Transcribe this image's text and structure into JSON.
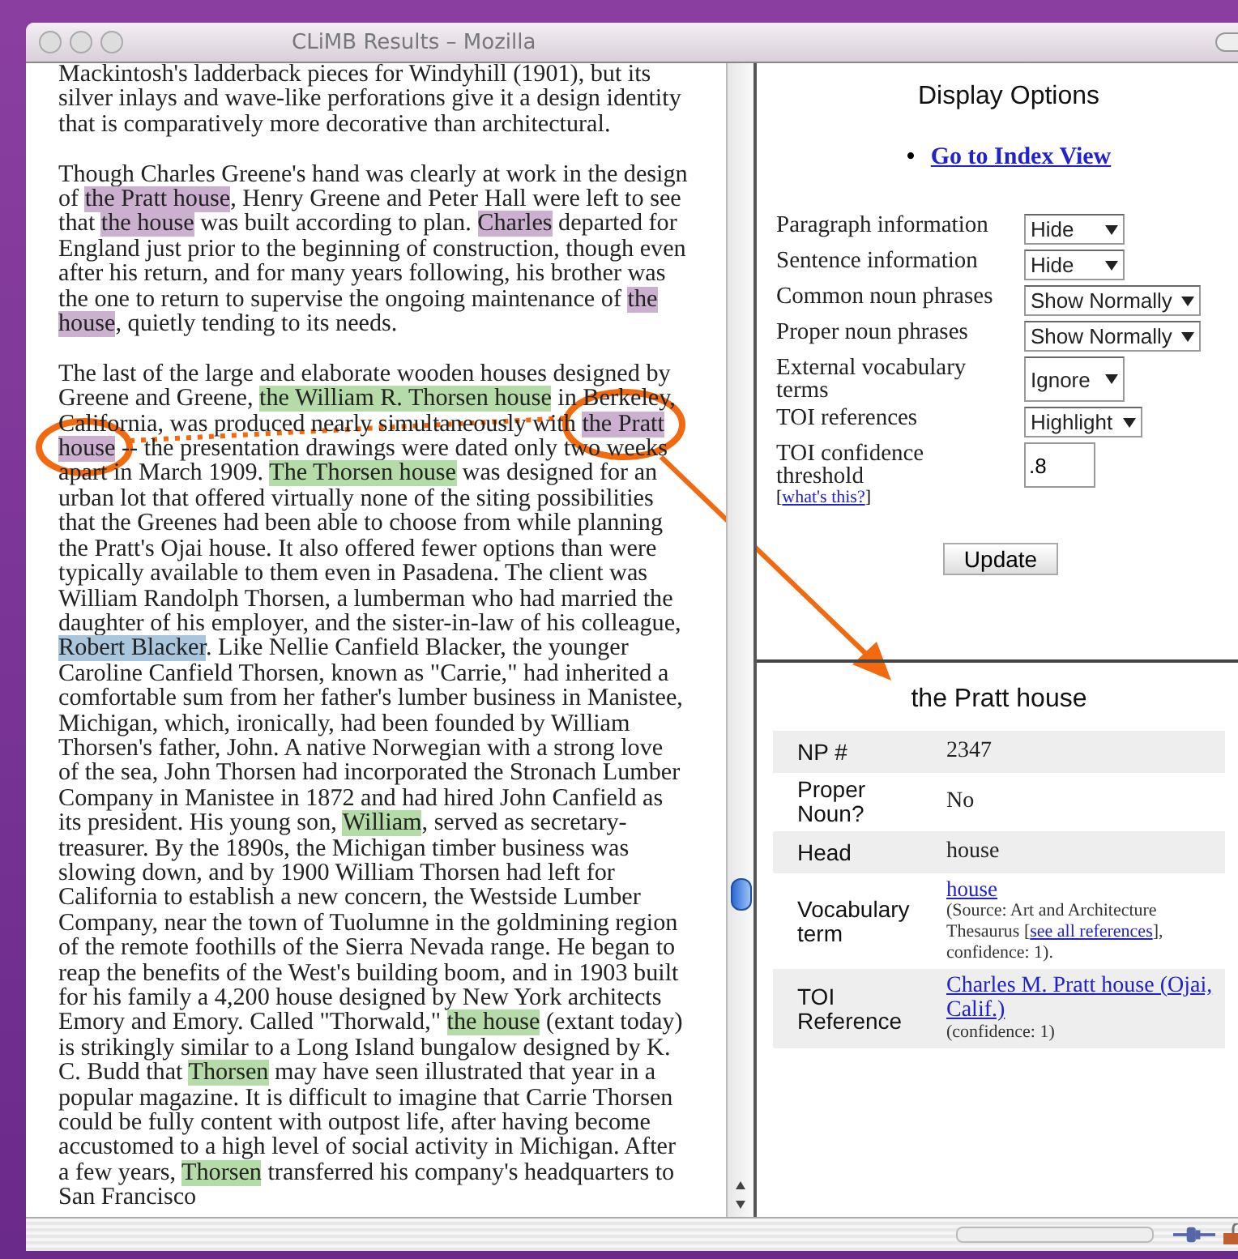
{
  "window": {
    "title": "CLiMB Results – Mozilla"
  },
  "document": {
    "paragraphs": [
      {
        "segments": [
          {
            "text": "Mackintosh's ladderback pieces for Windyhill (1901), but its silver inlays and wave-like perforations give it a design identity that is comparatively more decorative than architectural."
          }
        ]
      },
      {
        "segments": [
          {
            "text": "Though Charles Greene's hand was clearly at work in the design of "
          },
          {
            "text": "the Pratt house",
            "color": "#cbb0d0"
          },
          {
            "text": ", Henry Greene and Peter Hall were left to see that "
          },
          {
            "text": "the house",
            "color": "#cbb0d0"
          },
          {
            "text": " was built according to plan. "
          },
          {
            "text": "Charles",
            "color": "#cbb0d0"
          },
          {
            "text": " departed for England just prior to the beginning of construction, though even after his return, and for many years following, his brother was the one to return to supervise the ongoing maintenance of "
          },
          {
            "text": "the house",
            "color": "#cbb0d0"
          },
          {
            "text": ", quietly tending to its needs."
          }
        ]
      },
      {
        "segments": [
          {
            "text": "The last of the large and elaborate wooden houses designed by Greene and Greene, "
          },
          {
            "text": "the William R. Thorsen house",
            "color": "#b5dca8"
          },
          {
            "text": " in Berkeley, California, was produced nearly simultaneously with "
          },
          {
            "text": "the Pratt house",
            "color": "#cbb0d0"
          },
          {
            "text": " -- the presentation drawings were dated only two weeks apart in March 1909. "
          },
          {
            "text": "The Thorsen house",
            "color": "#b5dca8"
          },
          {
            "text": " was designed for an urban lot that offered virtually none of the siting possibilities that the Greenes had been able to choose from while planning the Pratt's Ojai house. It also offered fewer options than were typically available to them even in Pasadena. The client was William Randolph Thorsen, a lumberman who had married the daughter of his employer, and the sister-in-law of his colleague, "
          },
          {
            "text": "Robert Blacker",
            "color": "#aac6dc"
          },
          {
            "text": ". Like Nellie Canfield Blacker, the younger Caroline Canfield Thorsen, known as \"Carrie,\" had inherited a comfortable sum from her father's lumber business in Manistee, Michigan, which, ironically, had been founded by William Thorsen's father, John. A native Norwegian with a strong love of the sea, John Thorsen had incorporated the Stronach Lumber Company in Manistee in 1872 and had hired John Canfield as its president. His young son, "
          },
          {
            "text": "William",
            "color": "#b5dca8"
          },
          {
            "text": ", served as secretary-treasurer. By the 1890s, the Michigan timber business was slowing down, and by 1900 William Thorsen had left for California to establish a new concern, the Westside Lumber Company, near the town of Tuolumne in the goldmining region of the remote foothills of the Sierra Nevada range. He began to reap the benefits of the West's building boom, and in 1903 built for his family a 4,200 house designed by New York architects Emory and Emory. Called \"Thorwald,\" "
          },
          {
            "text": "the house",
            "color": "#b5dca8"
          },
          {
            "text": " (extant today) is strikingly similar to a Long Island bungalow designed by K. C. Budd that "
          },
          {
            "text": "Thorsen",
            "color": "#b5dca8"
          },
          {
            "text": " may have seen illustrated that year in a popular magazine. It is difficult to imagine that Carrie Thorsen could be fully content with outpost life, after having become accustomed to a high level of social activity in Michigan. After a few years, "
          },
          {
            "text": "Thorsen",
            "color": "#b5dca8"
          },
          {
            "text": " transferred his company's headquarters to San Francisco"
          }
        ]
      }
    ]
  },
  "display_options": {
    "title": "Display Options",
    "bullet": "•",
    "index_link": "Go to Index View",
    "options": [
      {
        "label": "Paragraph information",
        "value": "Hide"
      },
      {
        "label": "Sentence information",
        "value": "Hide"
      },
      {
        "label": "Common noun phrases",
        "value": "Show Normally"
      },
      {
        "label": "Proper noun phrases",
        "value": "Show Normally"
      },
      {
        "label": "External vocabulary terms",
        "value": "Ignore"
      },
      {
        "label": "TOI references",
        "value": "Highlight"
      }
    ],
    "threshold": {
      "label": "TOI confidence threshold",
      "value": ".8"
    },
    "help": {
      "open": "[",
      "link": "what's this?",
      "close": "]"
    },
    "button": "Update"
  },
  "np_detail": {
    "title": "the Pratt house",
    "rows": [
      {
        "kind": "text",
        "label": "NP #",
        "value": "2347"
      },
      {
        "kind": "text",
        "label": "Proper Noun?",
        "value": "No"
      },
      {
        "kind": "text",
        "label": "Head",
        "value": "house"
      },
      {
        "kind": "vocabulary",
        "label": "Vocabulary term",
        "link": "house",
        "note_before": "(Source: Art and Architecture Thesaurus [",
        "note_link": "see all references",
        "note_after": "], confidence: 1)."
      },
      {
        "kind": "reference",
        "label": "TOI Reference",
        "link": "Charles M. Pratt house (Ojai, Calif.)",
        "note": "(confidence: 1)"
      }
    ]
  },
  "status_bar": {
    "progress": {
      "level": 0
    }
  }
}
